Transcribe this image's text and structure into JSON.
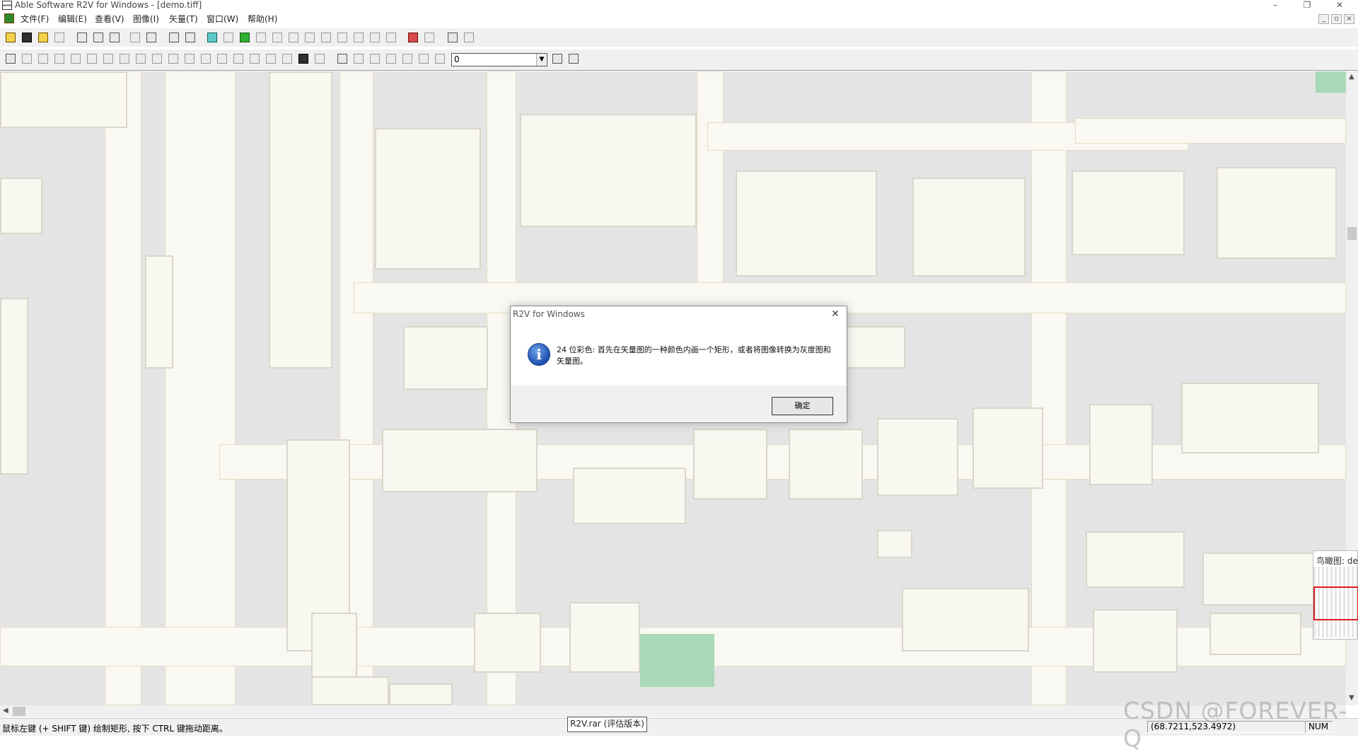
{
  "window": {
    "title": "Able Software R2V for Windows - [demo.tiff]",
    "minimize": "–",
    "restore": "❐",
    "close": "✕"
  },
  "menu": {
    "items": [
      "文件(F)",
      "编辑(E)",
      "查看(V)",
      "图像(I)",
      "矢量(T)",
      "窗口(W)",
      "帮助(H)"
    ]
  },
  "toolbar": {
    "line_combo_value": "0"
  },
  "dialog": {
    "title": "R2V for Windows",
    "close": "✕",
    "icon": "info-icon",
    "message": "24 位彩色: 首先在矢量图的一种颜色内画一个矩形，或者将图像转换为灰度图和矢量图。",
    "ok_label": "确定"
  },
  "overview": {
    "title": "鸟瞰图: demo.tiff"
  },
  "statusbar": {
    "hint": "鼠标左键 (+ SHIFT 键) 绘制矩形, 按下 CTRL 键拖动距离。",
    "coords": "(68.7211,523.4972)",
    "num": "NUM"
  },
  "tooltip": {
    "text": "R2V.rar (评估版本)"
  },
  "watermark": {
    "text": "CSDN @FOREVER-Q"
  },
  "colors": {
    "map_background": "#e4e4e4",
    "road": "#faf8f2",
    "building": "#f8f7f0",
    "park": "#a8d9b8",
    "dialog_icon": "#1d4fb1"
  }
}
